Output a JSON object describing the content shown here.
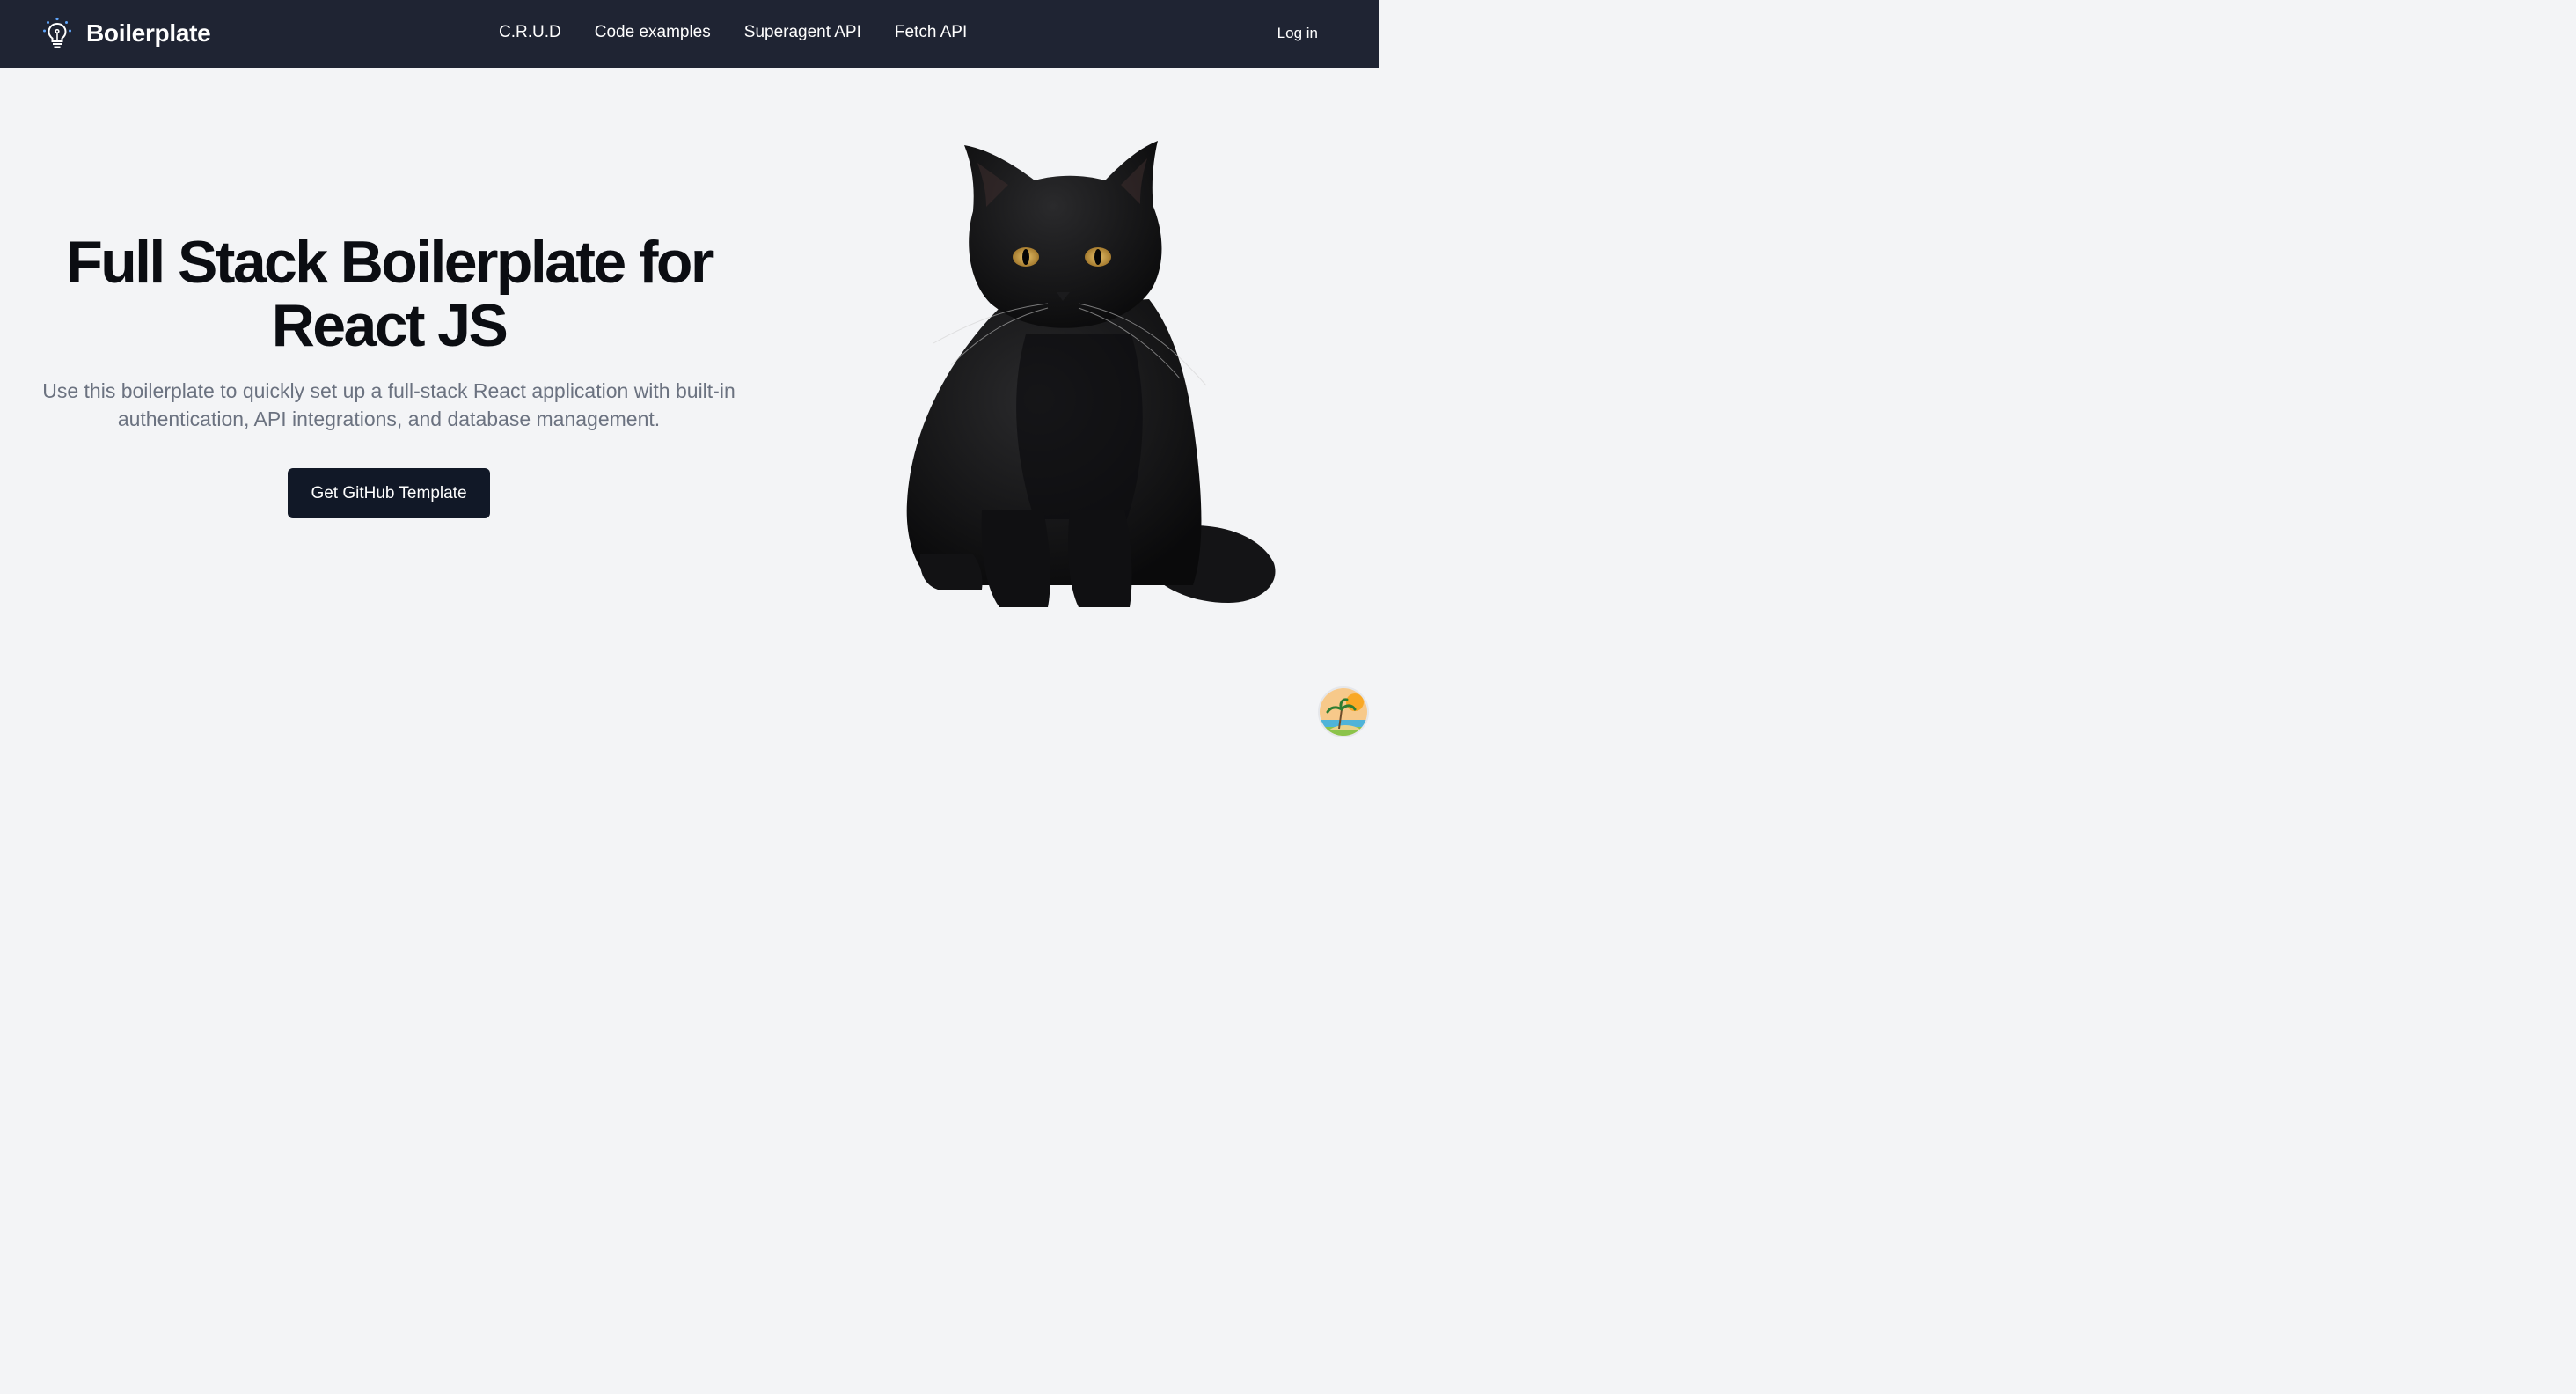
{
  "header": {
    "brand": "Boilerplate",
    "nav": [
      "C.R.U.D",
      "Code examples",
      "Superagent API",
      "Fetch API"
    ],
    "login": "Log in"
  },
  "hero": {
    "title_line1": "Full Stack Boilerplate for",
    "title_line2": "React JS",
    "subtitle": "Use this boilerplate to quickly set up a full-stack React application with built-in authentication, API integrations, and database management.",
    "cta": "Get GitHub Template"
  },
  "colors": {
    "nav_bg": "#1f2433",
    "page_bg": "#f3f4f6",
    "button_bg": "#111827",
    "subtitle": "#6b7280"
  },
  "icons": [
    "lightbulb-icon",
    "black-cat-image",
    "beach-avatar-icon"
  ]
}
